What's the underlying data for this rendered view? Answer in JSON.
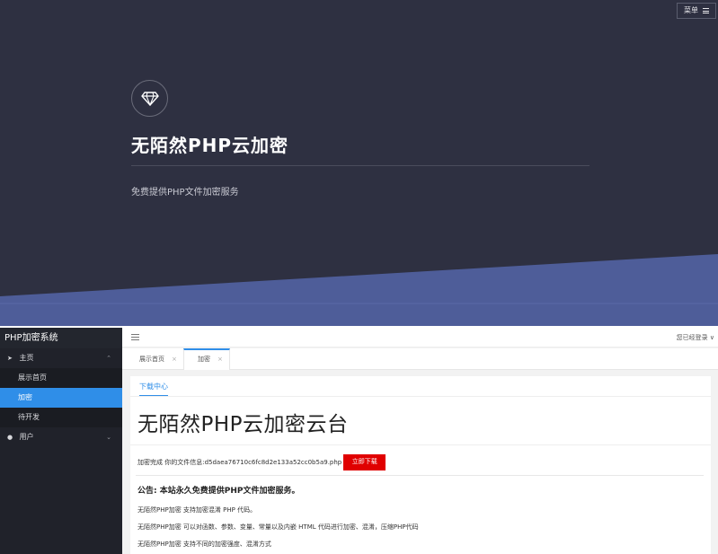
{
  "hero": {
    "menu_label": "菜单",
    "title": "无陌然PHP云加密",
    "subtitle": "免费提供PHP文件加密服务",
    "logo_icon": "diamond-icon",
    "colors": {
      "background": "#2e3041",
      "band": "#4e5d99"
    }
  },
  "admin": {
    "brand": "PHP加密系统",
    "sidebar": {
      "groups": [
        {
          "label": "主页",
          "icon": "paper-plane-icon",
          "expanded": true,
          "items": [
            {
              "label": "展示首页",
              "active": false
            },
            {
              "label": "加密",
              "active": true
            },
            {
              "label": "待开发",
              "active": false
            }
          ]
        },
        {
          "label": "用户",
          "icon": "user-icon",
          "expanded": false,
          "items": []
        }
      ]
    },
    "topbar": {
      "login_status": "您已经登录 ∨"
    },
    "tabs": [
      {
        "label": "展示首页",
        "active": false
      },
      {
        "label": "加密",
        "active": true
      }
    ],
    "content": {
      "tab": "下载中心",
      "title": "无陌然PHP云加密云台",
      "file_info": "加密完成 你的文件信息:d5daea76710c6fc8d2e133a52cc0b5a9.php",
      "download_label": "立即下载",
      "notice": "公告: 本站永久免费提供PHP文件加密服务。",
      "features": [
        "无陌然PHP加密 支持加密混淆 PHP 代码。",
        "无陌然PHP加密 可以对函数、参数、变量、常量以及内嵌 HTML 代码进行加密、混淆，压缩PHP代码",
        "无陌然PHP加密 支持不同的加密强度、混淆方式"
      ]
    },
    "colors": {
      "accent": "#2f8ee8",
      "danger": "#e00000",
      "sidebar": "#20222a"
    }
  }
}
